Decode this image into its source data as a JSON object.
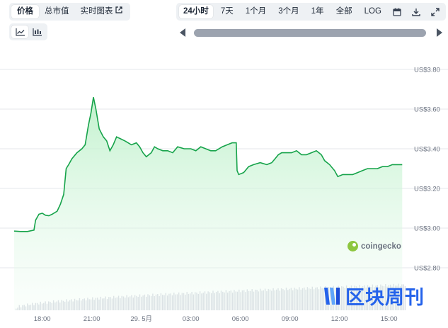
{
  "metric_tabs": [
    {
      "label": "价格",
      "active": true
    },
    {
      "label": "总市值",
      "active": false
    },
    {
      "label": "实时图表",
      "active": false,
      "external": true
    }
  ],
  "external_icon": "external-link-icon",
  "range_tabs": [
    {
      "label": "24小时",
      "active": true
    },
    {
      "label": "7天",
      "active": false
    },
    {
      "label": "1个月",
      "active": false
    },
    {
      "label": "3个月",
      "active": false
    },
    {
      "label": "1年",
      "active": false
    },
    {
      "label": "全部",
      "active": false
    },
    {
      "label": "LOG",
      "active": false
    }
  ],
  "range_icons": [
    "calendar-icon",
    "download-icon",
    "fullscreen-icon"
  ],
  "chart_type_icons": [
    "line-chart-icon",
    "candlestick-icon"
  ],
  "brand": {
    "name": "coingecko",
    "color": "#8dc63f"
  },
  "watermark": {
    "text": "区块周刊",
    "color": "#2563eb"
  },
  "colors": {
    "line": "#16a34a",
    "fill_top": "#bbf0c8",
    "volume": "#d8dce3"
  },
  "chart_data": {
    "type": "area",
    "y_ticks": [
      "US$3.80",
      "US$3.60",
      "US$3.40",
      "US$3.20",
      "US$3.00",
      "US$2.80"
    ],
    "x_ticks": [
      "18:00",
      "21:00",
      "29. 5月",
      "03:00",
      "06:00",
      "09:00",
      "12:00",
      "15:00"
    ],
    "ylim": [
      2.8,
      3.8
    ],
    "x_range_hours": [
      16.3,
      40.0
    ],
    "x_tick_hours": [
      18,
      21,
      24,
      27,
      30,
      33,
      36,
      39
    ],
    "grid": true,
    "series": [
      {
        "points": [
          [
            16.3,
            2.985
          ],
          [
            16.7,
            2.983
          ],
          [
            17.1,
            2.983
          ],
          [
            17.5,
            2.99
          ],
          [
            17.6,
            3.04
          ],
          [
            17.8,
            3.07
          ],
          [
            18.0,
            3.075
          ],
          [
            18.2,
            3.065
          ],
          [
            18.4,
            3.062
          ],
          [
            18.6,
            3.07
          ],
          [
            18.9,
            3.085
          ],
          [
            19.1,
            3.12
          ],
          [
            19.3,
            3.17
          ],
          [
            19.45,
            3.3
          ],
          [
            19.6,
            3.32
          ],
          [
            19.8,
            3.35
          ],
          [
            20.1,
            3.38
          ],
          [
            20.4,
            3.4
          ],
          [
            20.6,
            3.42
          ],
          [
            20.8,
            3.52
          ],
          [
            20.95,
            3.58
          ],
          [
            21.1,
            3.66
          ],
          [
            21.25,
            3.6
          ],
          [
            21.45,
            3.5
          ],
          [
            21.7,
            3.46
          ],
          [
            21.9,
            3.44
          ],
          [
            22.1,
            3.39
          ],
          [
            22.3,
            3.42
          ],
          [
            22.5,
            3.46
          ],
          [
            22.75,
            3.45
          ],
          [
            23.0,
            3.44
          ],
          [
            23.2,
            3.43
          ],
          [
            23.4,
            3.42
          ],
          [
            23.7,
            3.43
          ],
          [
            23.9,
            3.41
          ],
          [
            24.1,
            3.38
          ],
          [
            24.3,
            3.36
          ],
          [
            24.6,
            3.38
          ],
          [
            24.8,
            3.41
          ],
          [
            25.0,
            3.4
          ],
          [
            25.3,
            3.39
          ],
          [
            25.6,
            3.39
          ],
          [
            25.9,
            3.38
          ],
          [
            26.2,
            3.41
          ],
          [
            26.6,
            3.4
          ],
          [
            27.0,
            3.4
          ],
          [
            27.3,
            3.39
          ],
          [
            27.6,
            3.41
          ],
          [
            27.9,
            3.4
          ],
          [
            28.2,
            3.39
          ],
          [
            28.5,
            3.39
          ],
          [
            28.9,
            3.41
          ],
          [
            29.2,
            3.42
          ],
          [
            29.5,
            3.43
          ],
          [
            29.75,
            3.43
          ],
          [
            29.8,
            3.29
          ],
          [
            29.9,
            3.27
          ],
          [
            30.2,
            3.28
          ],
          [
            30.5,
            3.31
          ],
          [
            30.8,
            3.32
          ],
          [
            31.2,
            3.33
          ],
          [
            31.6,
            3.32
          ],
          [
            31.9,
            3.33
          ],
          [
            32.1,
            3.35
          ],
          [
            32.3,
            3.37
          ],
          [
            32.5,
            3.38
          ],
          [
            32.8,
            3.38
          ],
          [
            33.1,
            3.38
          ],
          [
            33.4,
            3.39
          ],
          [
            33.7,
            3.37
          ],
          [
            34.0,
            3.37
          ],
          [
            34.3,
            3.38
          ],
          [
            34.6,
            3.39
          ],
          [
            34.9,
            3.37
          ],
          [
            35.1,
            3.34
          ],
          [
            35.4,
            3.32
          ],
          [
            35.7,
            3.29
          ],
          [
            35.9,
            3.26
          ],
          [
            36.2,
            3.27
          ],
          [
            36.5,
            3.27
          ],
          [
            36.8,
            3.27
          ],
          [
            37.1,
            3.28
          ],
          [
            37.4,
            3.29
          ],
          [
            37.7,
            3.3
          ],
          [
            38.0,
            3.3
          ],
          [
            38.3,
            3.3
          ],
          [
            38.6,
            3.31
          ],
          [
            38.9,
            3.31
          ],
          [
            39.2,
            3.32
          ],
          [
            39.5,
            3.32
          ],
          [
            39.8,
            3.32
          ]
        ]
      }
    ]
  }
}
